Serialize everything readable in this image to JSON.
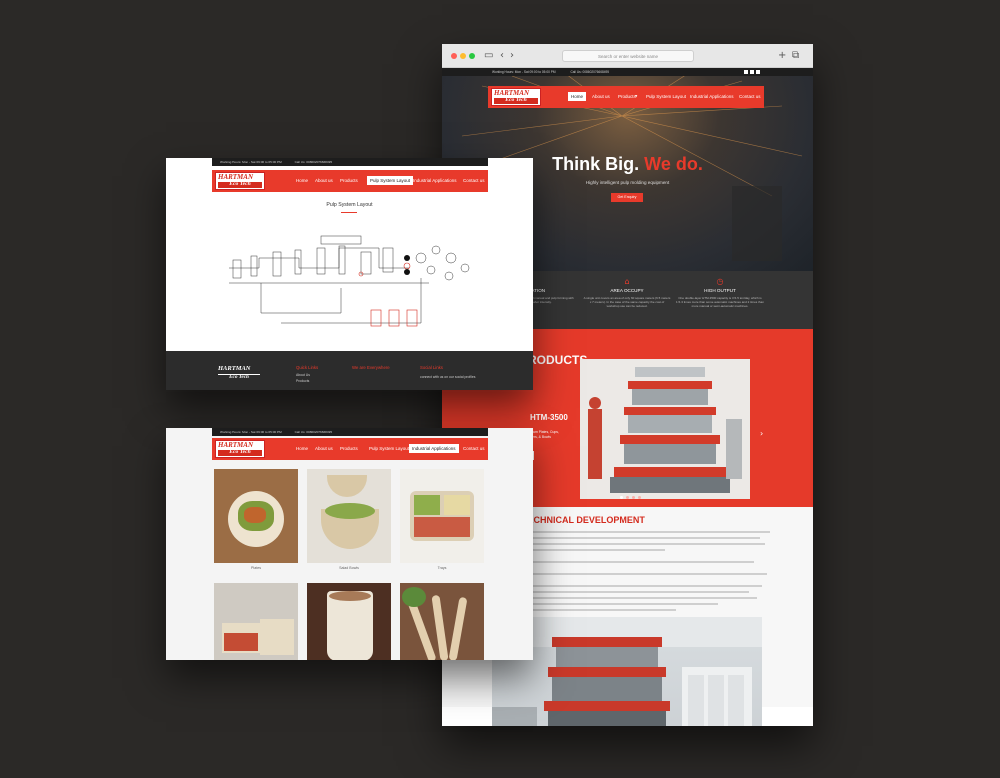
{
  "browser": {
    "url_placeholder": "Search or enter website name",
    "icons": {
      "sidebar": "sidebar-icon",
      "back": "chevron-left-icon",
      "forward": "chevron-right-icon",
      "new_tab": "plus-icon",
      "tabs": "tabs-icon"
    },
    "window_buttons": {
      "close": "#ff5f57",
      "minimize": "#febc2e",
      "maximize": "#28c840"
    }
  },
  "site": {
    "top_bar": {
      "hours": "Working Hours: Mon - Sat 09:00 to 05:00 PM",
      "call": "Call Us: 008602076668495"
    },
    "logo": {
      "line1": "HARTMAN",
      "line2": "Eco Tech"
    },
    "nav": [
      "Home",
      "About us",
      "Products",
      "Pulp System Layout",
      "Industrial Applications",
      "Contact us"
    ],
    "hero": {
      "title_white": "Think Big.",
      "title_red": "We do.",
      "subtitle": "Highly intelligent pulp molding equipment",
      "button": "Get Enquiry"
    },
    "features": [
      {
        "icon": "gear-icon",
        "title": "AUTOMATION",
        "text": "The system has replaced traditional manual and pulp forming with robotic operation, labor intensity."
      },
      {
        "icon": "home-icon",
        "title": "AREA OCCUPY",
        "text": "A single unit covers an area of only 60 square meters (6.5 meters x 7 meters). In the case of the same capacity the cost of workshop use can be reduced."
      },
      {
        "icon": "clock-icon",
        "title": "HIGH OUTPUT",
        "text": "One double-layer HTM-3500 capacity is 3.5-5 ton/day, which is 1.5-3 times more than some automatic machines and 2 times than more manual or semi-automatic machines."
      }
    ],
    "products": {
      "title": "PRODUCTS",
      "model": "HTM-3500",
      "desc": "Producing Premium Plates, Cups, Cutlery, Containers, & Bowls",
      "button": "See More",
      "slides": 4,
      "active_slide": 1
    },
    "development": {
      "title": "TECHNICAL DEVELOPMENT"
    }
  },
  "pulp_page": {
    "title": "Pulp System Layout",
    "footer": {
      "quick_links": "Quick Links",
      "links": [
        "About Us",
        "Products"
      ],
      "everywhere": "We are Everywhere",
      "social": "Social Links",
      "social_text": "connect with us on our social profiles"
    }
  },
  "applications": {
    "tiles": [
      {
        "caption": "Plates",
        "color": "#b88a5c"
      },
      {
        "caption": "Salad Bowls",
        "color": "#d8d2c4"
      },
      {
        "caption": "Trays",
        "color": "#e9e6df"
      },
      {
        "caption": "",
        "color": "#c44c34"
      },
      {
        "caption": "",
        "color": "#8a6048"
      },
      {
        "caption": "",
        "color": "#6d4a36"
      }
    ]
  },
  "colors": {
    "brand_red": "#e83a2b",
    "dark": "#1d1d1d",
    "background": "#2b2927"
  }
}
